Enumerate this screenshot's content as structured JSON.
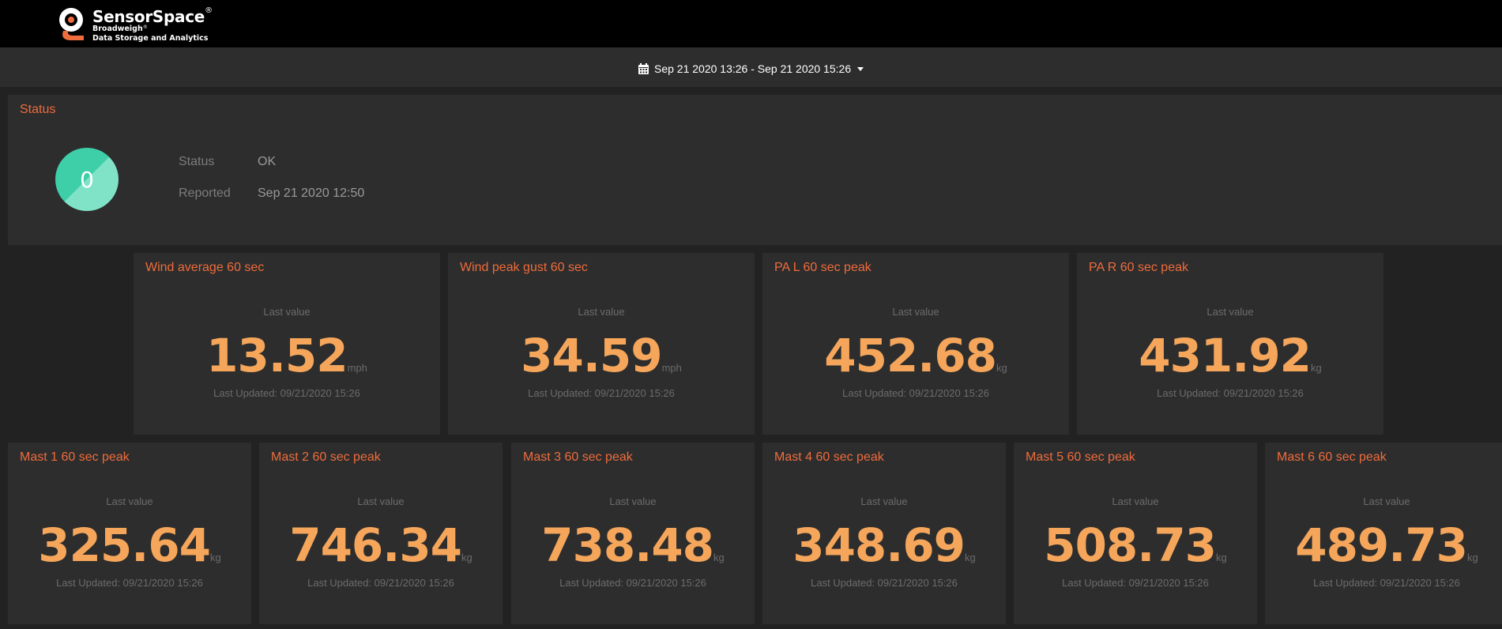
{
  "app": {
    "brand": "SensorSpace",
    "brand_mark": "®",
    "sub1": "Broadweigh",
    "sub1_mark": "®",
    "sub2": "Data Storage and Analytics"
  },
  "daterange": {
    "icon": "calendar-icon",
    "label": "Sep 21 2020 13:26 - Sep 21 2020 15:26",
    "caret_icon": "caret-down-icon"
  },
  "status": {
    "title": "Status",
    "badge_value": "0",
    "status_label": "Status",
    "status_value": "OK",
    "reported_label": "Reported",
    "reported_value": "Sep 21 2020 12:50",
    "colors": {
      "circle_dark": "#3ecfa9",
      "circle_light": "#80e3c8"
    }
  },
  "tiles_row1": [
    {
      "title": "Wind average 60 sec",
      "last_label": "Last value",
      "value": "13.52",
      "unit": "mph",
      "updated": "Last Updated: 09/21/2020 15:26"
    },
    {
      "title": "Wind peak gust 60 sec",
      "last_label": "Last value",
      "value": "34.59",
      "unit": "mph",
      "updated": "Last Updated: 09/21/2020 15:26"
    },
    {
      "title": "PA L 60 sec peak",
      "last_label": "Last value",
      "value": "452.68",
      "unit": "kg",
      "updated": "Last Updated: 09/21/2020 15:26"
    },
    {
      "title": "PA R 60 sec peak",
      "last_label": "Last value",
      "value": "431.92",
      "unit": "kg",
      "updated": "Last Updated: 09/21/2020 15:26"
    }
  ],
  "tiles_row2": [
    {
      "title": "Mast 1 60 sec peak",
      "last_label": "Last value",
      "value": "325.64",
      "unit": "kg",
      "updated": "Last Updated: 09/21/2020 15:26"
    },
    {
      "title": "Mast 2 60 sec peak",
      "last_label": "Last value",
      "value": "746.34",
      "unit": "kg",
      "updated": "Last Updated: 09/21/2020 15:26"
    },
    {
      "title": "Mast 3 60 sec peak",
      "last_label": "Last value",
      "value": "738.48",
      "unit": "kg",
      "updated": "Last Updated: 09/21/2020 15:26"
    },
    {
      "title": "Mast 4 60 sec peak",
      "last_label": "Last value",
      "value": "348.69",
      "unit": "kg",
      "updated": "Last Updated: 09/21/2020 15:26"
    },
    {
      "title": "Mast 5 60 sec peak",
      "last_label": "Last value",
      "value": "508.73",
      "unit": "kg",
      "updated": "Last Updated: 09/21/2020 15:26"
    },
    {
      "title": "Mast 6 60 sec peak",
      "last_label": "Last value",
      "value": "489.73",
      "unit": "kg",
      "updated": "Last Updated: 09/21/2020 15:26"
    }
  ],
  "theme": {
    "accent": "#ef6c3c",
    "value_color": "#f5a65b",
    "panel_bg": "#2d2d2d",
    "page_bg": "#222222"
  }
}
